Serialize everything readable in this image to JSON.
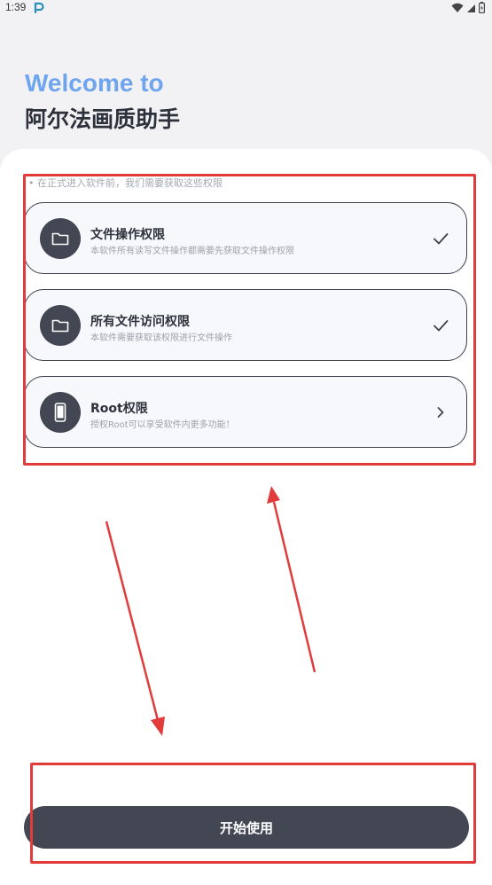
{
  "status_bar": {
    "time": "1:39",
    "app_icon": "app-p-icon",
    "icons": [
      "wifi-icon",
      "signal-icon",
      "battery-icon"
    ]
  },
  "header": {
    "welcome": "Welcome to",
    "app_name": "阿尔法画质助手"
  },
  "permissions": {
    "hint": "• 在正式进入软件前，我们需要获取这些权限",
    "items": [
      {
        "title": "文件操作权限",
        "desc": "本软件所有读写文件操作都需要先获取文件操作权限",
        "icon": "folder-icon",
        "status_icon": "check-icon",
        "granted": true
      },
      {
        "title": "所有文件访问权限",
        "desc": "本软件需要获取该权限进行文件操作",
        "icon": "folder-icon",
        "status_icon": "check-icon",
        "granted": true
      },
      {
        "title": "Root权限",
        "desc": "授权Root可以享受软件内更多功能！",
        "icon": "phone-icon",
        "status_icon": "chevron-right-icon",
        "granted": false
      }
    ]
  },
  "footer": {
    "start_label": "开始使用"
  },
  "colors": {
    "accent": "#6ea5ee",
    "primary_dark": "#434754",
    "annotation": "#e23b3b",
    "background": "#f2f2f4"
  }
}
